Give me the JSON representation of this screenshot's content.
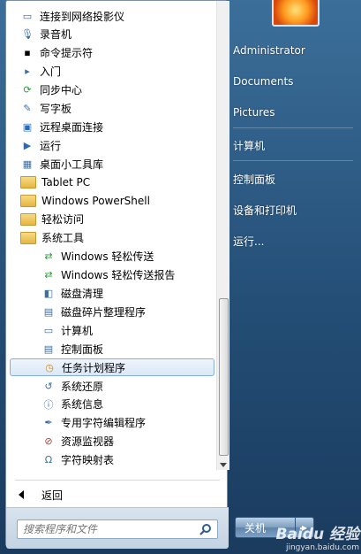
{
  "programs": {
    "items": [
      {
        "label": "连接到网络投影仪",
        "icon": "projector-icon",
        "indent": false,
        "selected": false
      },
      {
        "label": "录音机",
        "icon": "microphone-icon",
        "indent": false,
        "selected": false
      },
      {
        "label": "命令提示符",
        "icon": "command-prompt-icon",
        "indent": false,
        "selected": false
      },
      {
        "label": "入门",
        "icon": "getting-started-icon",
        "indent": false,
        "selected": false
      },
      {
        "label": "同步中心",
        "icon": "sync-icon",
        "indent": false,
        "selected": false
      },
      {
        "label": "写字板",
        "icon": "wordpad-icon",
        "indent": false,
        "selected": false
      },
      {
        "label": "远程桌面连接",
        "icon": "remote-desktop-icon",
        "indent": false,
        "selected": false
      },
      {
        "label": "运行",
        "icon": "run-icon",
        "indent": false,
        "selected": false
      },
      {
        "label": "桌面小工具库",
        "icon": "gadgets-icon",
        "indent": false,
        "selected": false
      },
      {
        "label": "Tablet PC",
        "icon": "folder-icon",
        "indent": false,
        "selected": false
      },
      {
        "label": "Windows PowerShell",
        "icon": "folder-icon",
        "indent": false,
        "selected": false
      },
      {
        "label": "轻松访问",
        "icon": "folder-icon",
        "indent": false,
        "selected": false
      },
      {
        "label": "系统工具",
        "icon": "folder-icon",
        "indent": false,
        "selected": false
      },
      {
        "label": "Windows 轻松传送",
        "icon": "easy-transfer-icon",
        "indent": true,
        "selected": false
      },
      {
        "label": "Windows 轻松传送报告",
        "icon": "easy-transfer-report-icon",
        "indent": true,
        "selected": false
      },
      {
        "label": "磁盘清理",
        "icon": "disk-cleanup-icon",
        "indent": true,
        "selected": false
      },
      {
        "label": "磁盘碎片整理程序",
        "icon": "defragmenter-icon",
        "indent": true,
        "selected": false
      },
      {
        "label": "计算机",
        "icon": "computer-icon",
        "indent": true,
        "selected": false
      },
      {
        "label": "控制面板",
        "icon": "control-panel-icon",
        "indent": true,
        "selected": false
      },
      {
        "label": "任务计划程序",
        "icon": "clock-icon",
        "indent": true,
        "selected": true
      },
      {
        "label": "系统还原",
        "icon": "system-restore-icon",
        "indent": true,
        "selected": false
      },
      {
        "label": "系统信息",
        "icon": "system-info-icon",
        "indent": true,
        "selected": false
      },
      {
        "label": "专用字符编辑程序",
        "icon": "char-editor-icon",
        "indent": true,
        "selected": false
      },
      {
        "label": "资源监视器",
        "icon": "resource-monitor-icon",
        "indent": true,
        "selected": false
      },
      {
        "label": "字符映射表",
        "icon": "character-map-icon",
        "indent": true,
        "selected": false
      }
    ],
    "back_label": "返回"
  },
  "search": {
    "placeholder": "搜索程序和文件"
  },
  "right_pane": {
    "items": [
      "Administrator",
      "Documents",
      "Pictures",
      "计算机",
      "控制面板",
      "设备和打印机",
      "运行..."
    ]
  },
  "shutdown": {
    "label": "关机"
  },
  "watermark": {
    "logo": "Baidu 经验",
    "url": "jingyan.baidu.com"
  },
  "colors": {
    "selection_border": "#85aee0",
    "panel_bg": "#244e76",
    "folder": "#e5b543"
  }
}
